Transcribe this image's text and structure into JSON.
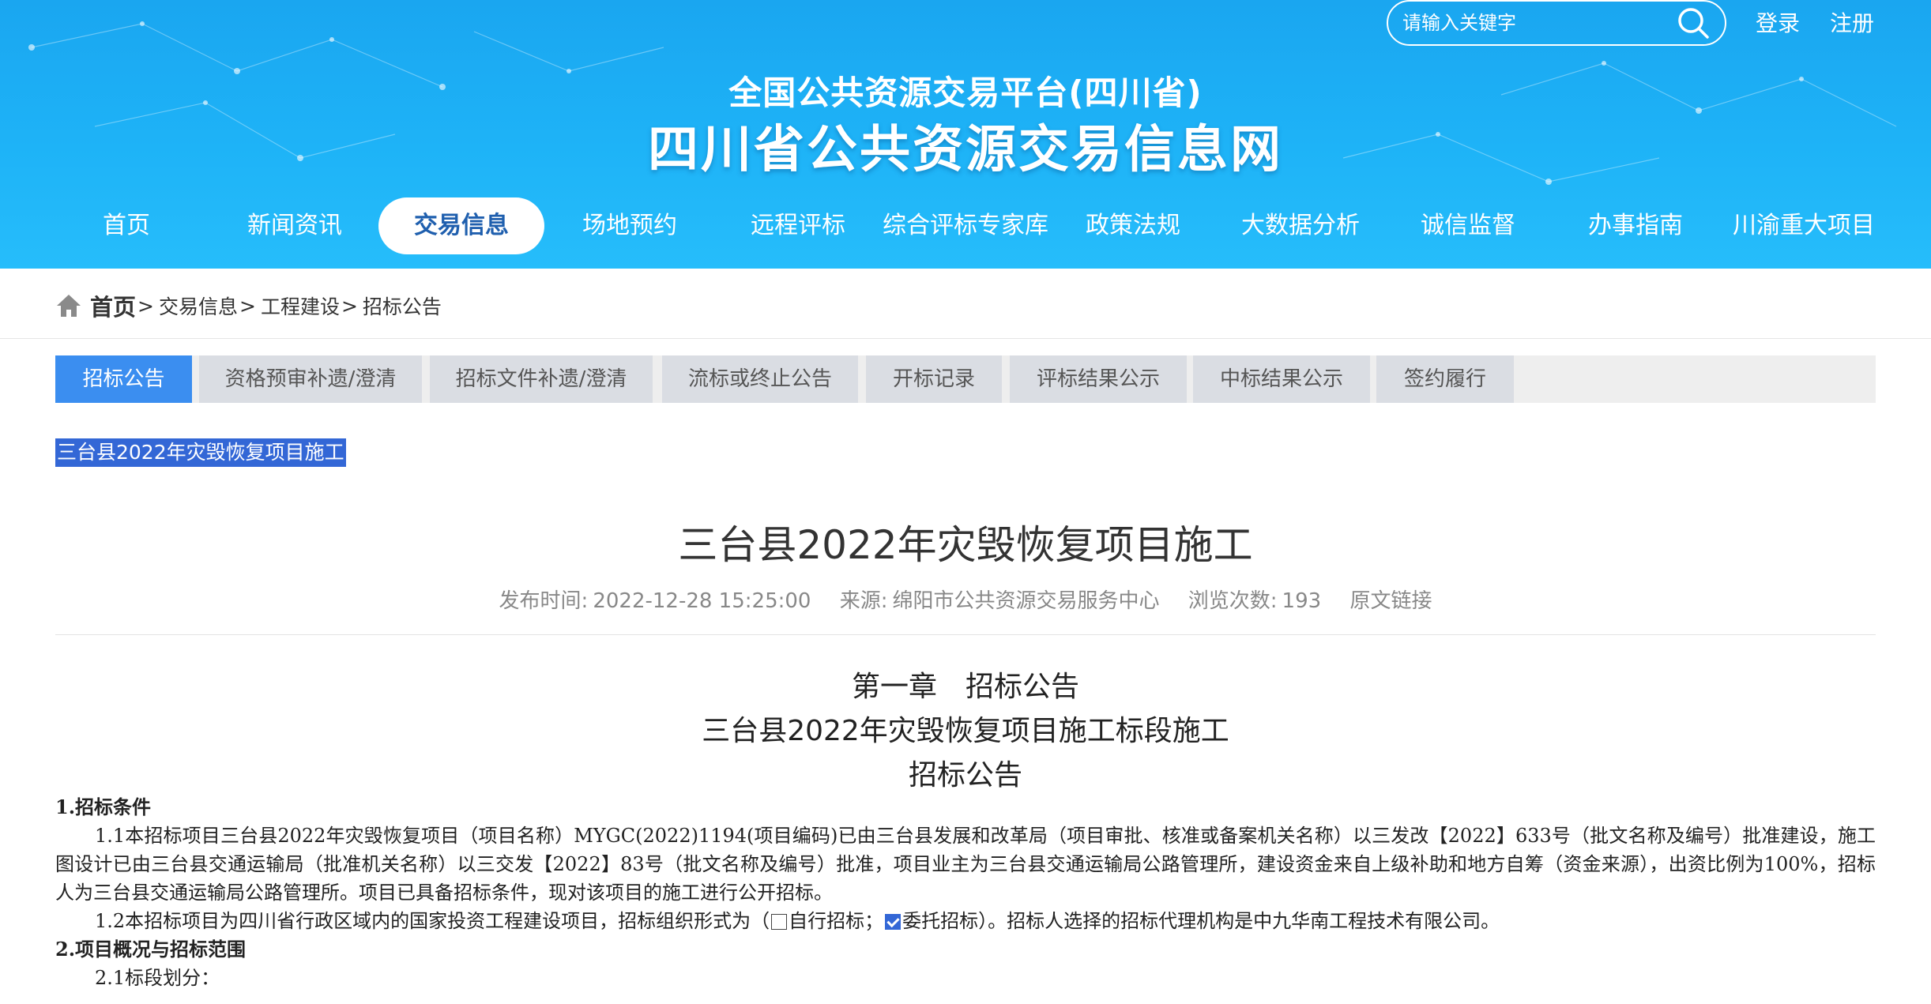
{
  "header": {
    "search_placeholder": "请输入关键字",
    "login": "登录",
    "register": "注册",
    "title_sub": "全国公共资源交易平台(四川省)",
    "title_main": "四川省公共资源交易信息网"
  },
  "nav": [
    {
      "label": "首页"
    },
    {
      "label": "新闻资讯"
    },
    {
      "label": "交易信息",
      "active": true
    },
    {
      "label": "场地预约"
    },
    {
      "label": "远程评标"
    },
    {
      "label": "综合评标专家库"
    },
    {
      "label": "政策法规"
    },
    {
      "label": "大数据分析"
    },
    {
      "label": "诚信监督"
    },
    {
      "label": "办事指南"
    },
    {
      "label": "川渝重大项目"
    }
  ],
  "breadcrumb": {
    "home": "首页",
    "items": [
      "交易信息",
      "工程建设",
      "招标公告"
    ]
  },
  "tabs": [
    {
      "label": "招标公告",
      "active": true
    },
    {
      "label": "资格预审补遗/澄清"
    },
    {
      "label": "招标文件补遗/澄清"
    },
    {
      "label": "流标或终止公告"
    },
    {
      "label": "开标记录"
    },
    {
      "label": "评标结果公示"
    },
    {
      "label": "中标结果公示"
    },
    {
      "label": "签约履行"
    }
  ],
  "selected_title": "三台县2022年灾毁恢复项目施工",
  "article": {
    "title": "三台县2022年灾毁恢复项目施工",
    "meta": {
      "publish_label": "发布时间:",
      "publish_time": "2022-12-28 15:25:00",
      "source_label": "来源:",
      "source": "绵阳市公共资源交易服务中心",
      "views_label": "浏览次数:",
      "views": "193",
      "original_link": "原文链接"
    },
    "chapter": "第一章　招标公告",
    "project_line": "三台县2022年灾毁恢复项目施工标段施工",
    "notice": "招标公告",
    "section1_head": "1.招标条件",
    "para_1_1": "1.1本招标项目三台县2022年灾毁恢复项目（项目名称）MYGC(2022)1194(项目编码)已由三台县发展和改革局（项目审批、核准或备案机关名称）以三发改【2022】633号（批文名称及编号）批准建设，施工图设计已由三台县交通运输局（批准机关名称）以三交发【2022】83号（批文名称及编号）批准，项目业主为三台县交通运输局公路管理所，建设资金来自上级补助和地方自筹（资金来源），出资比例为100%，招标人为三台县交通运输局公路管理所。项目已具备招标条件，现对该项目的施工进行公开招标。",
    "para_1_2_a": "1.2本招标项目为四川省行政区域内的国家投资工程建设项目，招标组织形式为（",
    "para_1_2_b": "自行招标；",
    "para_1_2_c": "委托招标）。招标人选择的招标代理机构是中九华南工程技术有限公司。",
    "section2_head": "2.项目概况与招标范围",
    "para_2_1": "2.1标段划分："
  }
}
